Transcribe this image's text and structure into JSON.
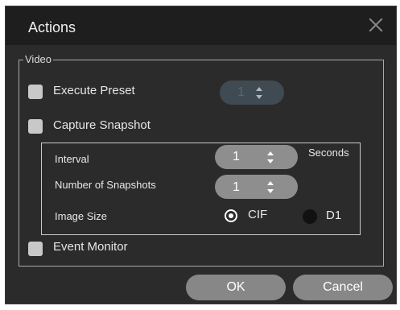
{
  "dialog": {
    "title": "Actions",
    "close_icon": "close-icon"
  },
  "video_group": {
    "legend": "Video",
    "execute_preset": {
      "label": "Execute Preset",
      "checked": false,
      "value": "1"
    },
    "capture_snapshot": {
      "label": "Capture Snapshot",
      "checked": false
    },
    "snapshot_settings": {
      "interval_label": "Interval",
      "interval_value": "1",
      "interval_unit": "Seconds",
      "count_label": "Number of Snapshots",
      "count_value": "1",
      "image_size_label": "Image Size",
      "options": [
        {
          "label": "CIF",
          "selected": true
        },
        {
          "label": "D1",
          "selected": false
        }
      ]
    },
    "event_monitor": {
      "label": "Event Monitor",
      "checked": false
    }
  },
  "buttons": {
    "ok": "OK",
    "cancel": "Cancel"
  },
  "colors": {
    "dialog_bg": "#2b2b2b",
    "titlebar_bg": "#1e1e1e",
    "button_bg": "#878787"
  }
}
